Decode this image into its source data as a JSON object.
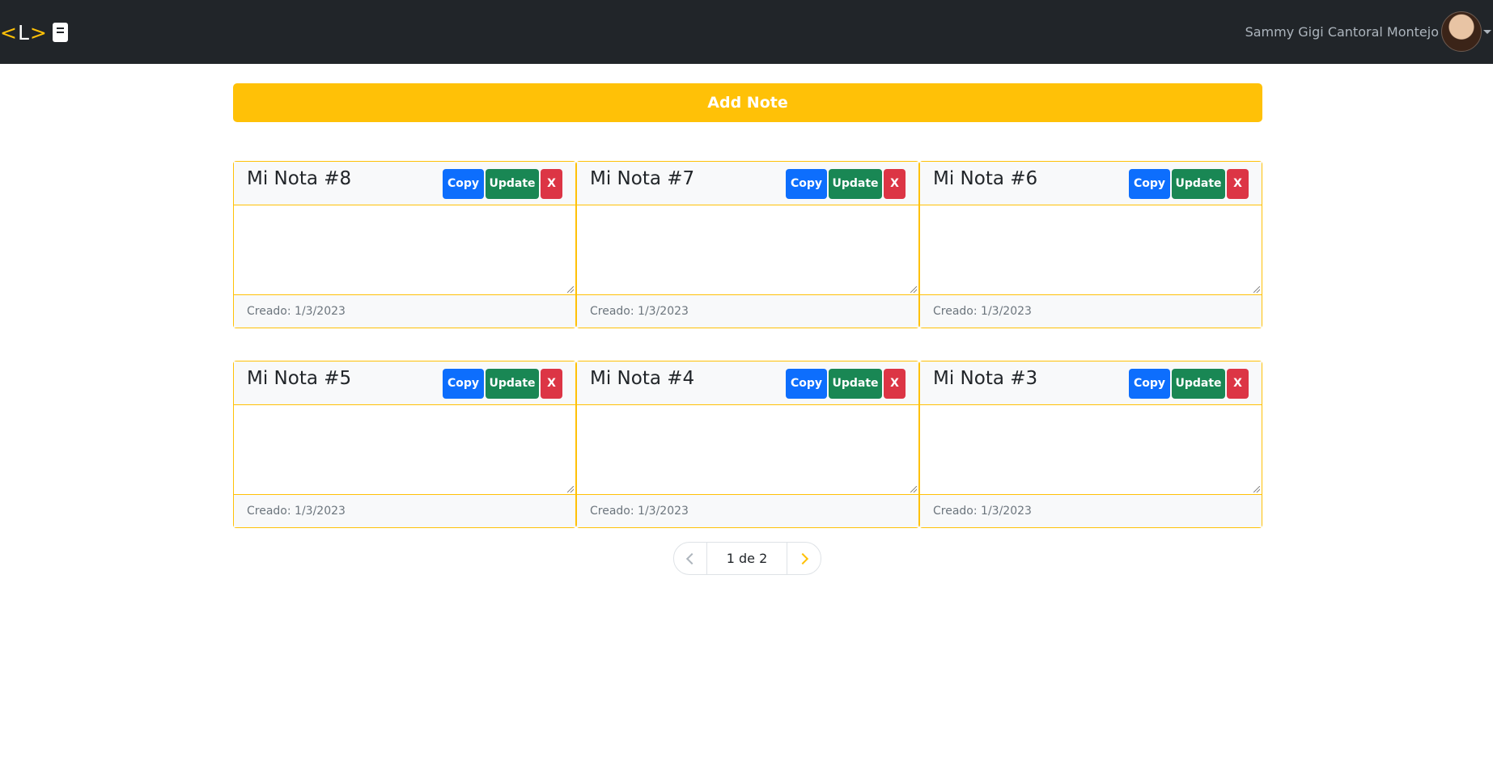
{
  "navbar": {
    "logo": {
      "open": "<",
      "letter": "L",
      "close": ">"
    },
    "user_name": "Sammy Gigi Cantoral Montejo",
    "icons": {
      "logo_book": "book-icon",
      "menu": "caret-down-icon"
    }
  },
  "actions": {
    "add_note_label": "Add Note"
  },
  "buttons": {
    "copy": "Copy",
    "update": "Update",
    "delete": "X"
  },
  "notes": [
    {
      "title": "Mi Nota #8",
      "content": "",
      "created": "Creado: 1/3/2023"
    },
    {
      "title": "Mi Nota #7",
      "content": "",
      "created": "Creado: 1/3/2023"
    },
    {
      "title": "Mi Nota #6",
      "content": "",
      "created": "Creado: 1/3/2023"
    },
    {
      "title": "Mi Nota #5",
      "content": "",
      "created": "Creado: 1/3/2023"
    },
    {
      "title": "Mi Nota #4",
      "content": "",
      "created": "Creado: 1/3/2023"
    },
    {
      "title": "Mi Nota #3",
      "content": "",
      "created": "Creado: 1/3/2023"
    }
  ],
  "pagination": {
    "label": "1 de 2"
  },
  "colors": {
    "navbar": "#212529",
    "accent": "#ffc107",
    "copy": "#0d6efd",
    "update": "#198754",
    "delete": "#dc3545"
  }
}
